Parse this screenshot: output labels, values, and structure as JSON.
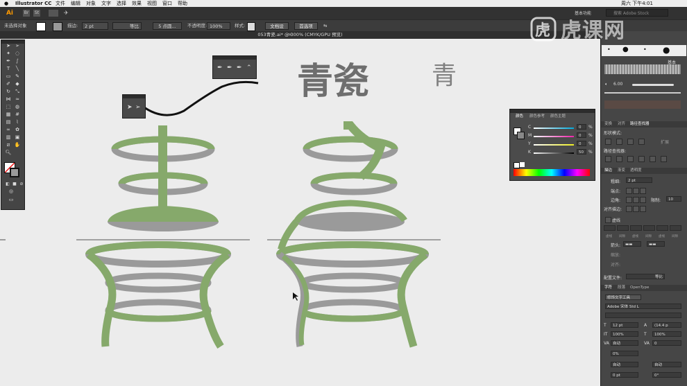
{
  "menubar": {
    "apple": "",
    "app": "Illustrator CC",
    "items": [
      "文件",
      "编辑",
      "对象",
      "文字",
      "选择",
      "效果",
      "视图",
      "窗口",
      "帮助"
    ],
    "clock": "周六 下午4:01",
    "workspace": "基本功能",
    "search_placeholder": "搜索 Adobe Stock"
  },
  "appbar": {
    "logo": "Ai",
    "br": "Br",
    "st": "St"
  },
  "control": {
    "selection": "未选择对象",
    "stroke_label": "描边:",
    "stroke_value": "2 pt",
    "profile": "等比",
    "brush": "5 点圆...",
    "opacity_label": "不透明度:",
    "opacity_value": "100%",
    "style_label": "样式:",
    "doc_setup": "文档设置",
    "prefs": "首选项"
  },
  "document": {
    "tab_title": "053青瓷.ai* @ 300% (CMYK/GPU 预览)"
  },
  "artwork": {
    "title": "青瓷",
    "small_glyph": "青",
    "green": "#86a96b",
    "gray": "#9a9a9a"
  },
  "color_panel": {
    "tabs": [
      "颜色",
      "颜色参考",
      "颜色主题"
    ],
    "rows": [
      {
        "label": "C",
        "value": "0",
        "unit": "%"
      },
      {
        "label": "M",
        "value": "0",
        "unit": "%"
      },
      {
        "label": "Y",
        "value": "0",
        "unit": "%"
      },
      {
        "label": "K",
        "value": "50",
        "unit": "%"
      }
    ]
  },
  "right_panels": {
    "brush_label": "基本",
    "brush_size": "6.00",
    "transform_tabs": [
      "变换",
      "对齐",
      "路径查找器"
    ],
    "shape_modes": "形状模式:",
    "expand": "扩展",
    "pathfinder": "路径查找器:",
    "stroke_tabs": [
      "描边",
      "渐变",
      "透明度"
    ],
    "weight_label": "粗细:",
    "weight_value": "2 pt",
    "cap_label": "端点:",
    "corner_label": "边角:",
    "limit_label": "限制:",
    "limit_value": "10",
    "align_label": "对齐描边:",
    "dashed_label": "虚线",
    "dash_row": [
      "虚线",
      "间隙",
      "虚线",
      "间隙",
      "虚线",
      "间隙"
    ],
    "arrow_label": "箭头:",
    "scale_label": "缩放:",
    "align2_label": "对齐:",
    "profile_label": "配置文件:",
    "profile_value": "等比",
    "char_tabs": [
      "字符",
      "段落",
      "OpenType"
    ],
    "touch_type": "修饰文字工具",
    "font": "Adobe 宋体 Std L",
    "font_size": "12 pt",
    "leading": "(14.4 p",
    "scale_v": "100%",
    "scale_h": "100%",
    "kern": "自动",
    "track": "0",
    "tsume": "0%",
    "aki_l": "自动",
    "aki_r": "自动",
    "baseline": "0 pt",
    "rotate": "0°"
  }
}
